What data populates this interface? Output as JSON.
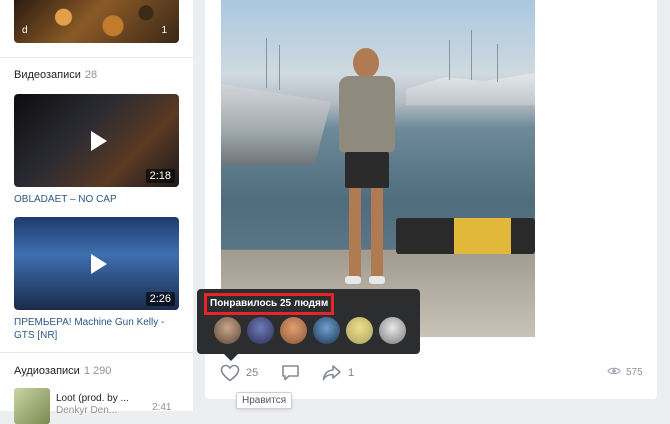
{
  "left": {
    "top_item": {
      "overlay_left": "d",
      "overlay_right": "1"
    },
    "videos_section": {
      "title": "Видеозаписи",
      "count": "28",
      "items": [
        {
          "title": "OBLADAET – NO CAP",
          "duration": "2:18"
        },
        {
          "title": "ПРЕМЬЕРА! Machine Gun Kelly - GTS [NR]",
          "duration": "2:26"
        }
      ]
    },
    "audio_section": {
      "title": "Аудиозаписи",
      "count": "1 290",
      "item": {
        "title": "Loot (prod. by ...",
        "artist": "Denkyr Den...",
        "duration": "2:41"
      }
    }
  },
  "post": {
    "likes_popup": {
      "title": "Понравилось 25 людям",
      "avatar_count": 6
    },
    "actions": {
      "likes": "25",
      "shares": "1",
      "views": "575"
    },
    "tooltip": "Нравится"
  },
  "colors": {
    "link": "#2a5885",
    "popup_bg": "#2c2d2e",
    "highlight_border": "#e2262a",
    "page_bg": "#edeef0"
  }
}
